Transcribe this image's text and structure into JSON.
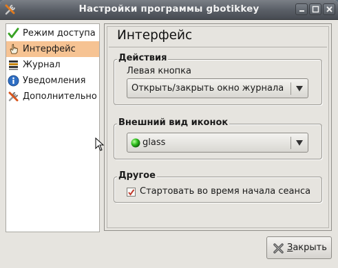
{
  "window": {
    "title": "Настройки программы gbotikkey"
  },
  "sidebar": {
    "items": [
      {
        "label": "Режим доступа",
        "icon": "checkmark-icon"
      },
      {
        "label": "Интерфейс",
        "icon": "hand-pointer-icon",
        "selected": true
      },
      {
        "label": "Журнал",
        "icon": "journal-icon"
      },
      {
        "label": "Уведомления",
        "icon": "info-icon"
      },
      {
        "label": "Дополнительно",
        "icon": "tools-icon"
      }
    ]
  },
  "panel": {
    "title": "Интерфейс",
    "groups": {
      "actions": {
        "label": "Действия",
        "left_button_label": "Левая кнопка",
        "left_button_value": "Открыть/закрыть окно журнала"
      },
      "appearance": {
        "label": "Внешний вид иконок",
        "icon_style_value": "glass",
        "icon_style_color": "#2fbf1f"
      },
      "other": {
        "label": "Другое",
        "start_on_login_label": "Стартовать во время начала сеанса",
        "start_on_login_checked": true
      }
    }
  },
  "buttons": {
    "close_label": "Закрыть",
    "close_mnemonic": "З",
    "close_rest": "акрыть"
  },
  "colors": {
    "selection": "#f6c393",
    "checkmark": "#c0392b"
  }
}
